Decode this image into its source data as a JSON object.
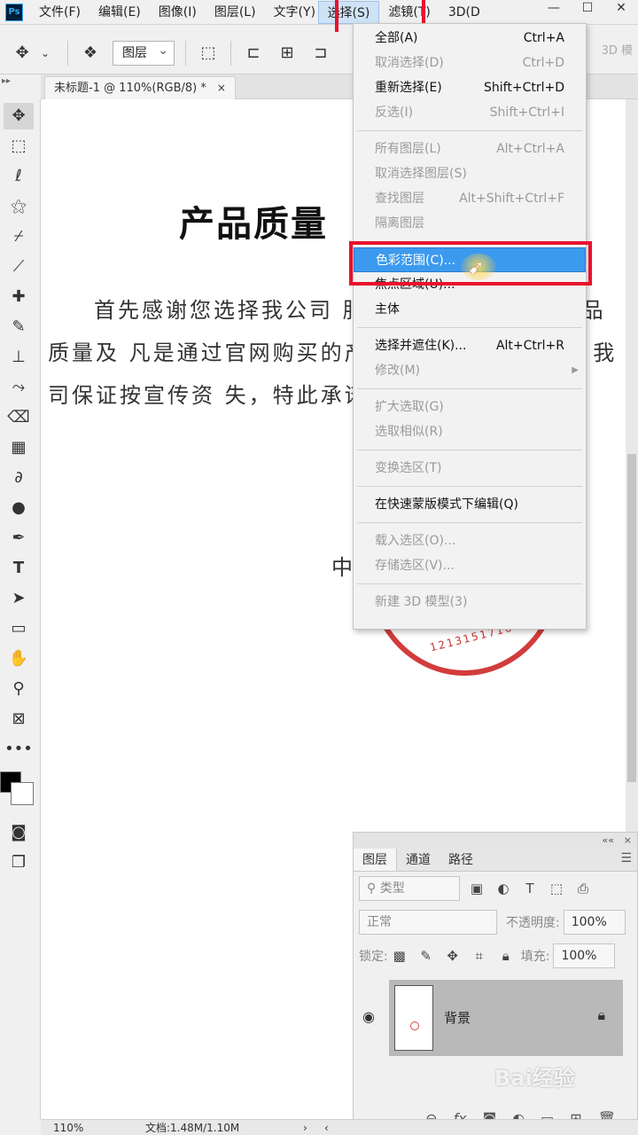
{
  "menubar": {
    "logo": "Ps",
    "items": [
      "文件(F)",
      "编辑(E)",
      "图像(I)",
      "图层(L)",
      "文字(Y)",
      "选择(S)",
      "滤镜(T)",
      "3D(D)"
    ],
    "window_buttons": [
      "—",
      "☐",
      "✕"
    ]
  },
  "options": {
    "layer_select": "图层",
    "icons": [
      "move-icon",
      "layer-stack-icon",
      "transform-controls-icon",
      "align-left-icon",
      "align-center-icon",
      "align-right-icon"
    ],
    "mode3d": "3D 模"
  },
  "tab": {
    "title": "未标题-1 @ 110%(RGB/8) *",
    "close": "×"
  },
  "document": {
    "title": "产品质量",
    "body": "首先感谢您选择我公司                        服务过程中我公司对产品质量及                        凡是通过官网购买的产品均为                        有质量问题，我司保证按宣传资                        失，特此承诺。",
    "signer": "中",
    "stamp_number": "1213151716"
  },
  "dropdown": {
    "items": [
      {
        "label": "全部(A)",
        "shortcut": "Ctrl+A",
        "disabled": false
      },
      {
        "label": "取消选择(D)",
        "shortcut": "Ctrl+D",
        "disabled": true
      },
      {
        "label": "重新选择(E)",
        "shortcut": "Shift+Ctrl+D",
        "disabled": false
      },
      {
        "label": "反选(I)",
        "shortcut": "Shift+Ctrl+I",
        "disabled": true
      },
      {
        "label": "所有图层(L)",
        "shortcut": "Alt+Ctrl+A",
        "disabled": true
      },
      {
        "label": "取消选择图层(S)",
        "shortcut": "",
        "disabled": true
      },
      {
        "label": "查找图层",
        "shortcut": "Alt+Shift+Ctrl+F",
        "disabled": true
      },
      {
        "label": "隔离图层",
        "shortcut": "",
        "disabled": true
      },
      {
        "label": "色彩范围(C)...",
        "shortcut": "",
        "disabled": false
      },
      {
        "label": "焦点区域(U)...",
        "shortcut": "",
        "disabled": false
      },
      {
        "label": "主体",
        "shortcut": "",
        "disabled": false
      },
      {
        "label": "选择并遮住(K)...",
        "shortcut": "Alt+Ctrl+R",
        "disabled": false
      },
      {
        "label": "修改(M)",
        "shortcut": "",
        "disabled": true
      },
      {
        "label": "扩大选取(G)",
        "shortcut": "",
        "disabled": true
      },
      {
        "label": "选取相似(R)",
        "shortcut": "",
        "disabled": true
      },
      {
        "label": "变换选区(T)",
        "shortcut": "",
        "disabled": true
      },
      {
        "label": "在快速蒙版模式下编辑(Q)",
        "shortcut": "",
        "disabled": false
      },
      {
        "label": "载入选区(O)...",
        "shortcut": "",
        "disabled": true
      },
      {
        "label": "存储选区(V)...",
        "shortcut": "",
        "disabled": true
      },
      {
        "label": "新建 3D 模型(3)",
        "shortcut": "",
        "disabled": true
      }
    ],
    "highlight_color": "#3c9aee"
  },
  "layers_panel": {
    "tabs": [
      "图层",
      "通道",
      "路径"
    ],
    "filter": "类型",
    "blend_mode": "正常",
    "opacity_label": "不透明度:",
    "opacity": "100%",
    "lock_label": "锁定:",
    "fill_label": "填充:",
    "fill": "100%",
    "layer_name": "背景",
    "collapse": "««",
    "close": "×"
  },
  "status": {
    "zoom": "110%",
    "doc": "文档:1.48M/1.10M"
  },
  "watermark": "Bai经验",
  "accent_red": "#e8112d"
}
